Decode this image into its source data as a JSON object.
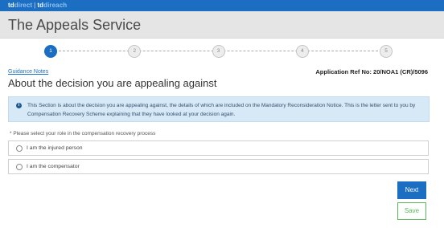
{
  "brand": {
    "part1_a": "td",
    "part1_b": "direct",
    "separator": "|",
    "part2_a": "td",
    "part2_b": "direach"
  },
  "header": {
    "title": "The Appeals Service"
  },
  "steps": {
    "current": 1,
    "items": [
      "1",
      "2",
      "3",
      "4",
      "5"
    ]
  },
  "guidance_link": "Guidance Notes",
  "application_ref": "Application Ref No: 20/NOA1 (CR)/5096",
  "page_title": "About the decision you are appealing against",
  "info_icon": "info-icon",
  "info_text": "This Section is about the decision you are appealing against, the details of which are included on the Mandatory Reconsideration Notice. This is the letter sent to you by Compensation Recovery Scheme explaining that they have looked at your decision again.",
  "question": "* Please select your role in the compensation recovery process",
  "options": [
    {
      "label": "I am the injured person",
      "selected": false
    },
    {
      "label": "I am the compensator",
      "selected": false
    }
  ],
  "buttons": {
    "next": "Next",
    "save": "Save"
  },
  "colors": {
    "primary": "#1b6ec2",
    "header_bg": "#e5e5e5",
    "info_bg": "#d7e8f6",
    "save_green": "#5cb85c"
  }
}
